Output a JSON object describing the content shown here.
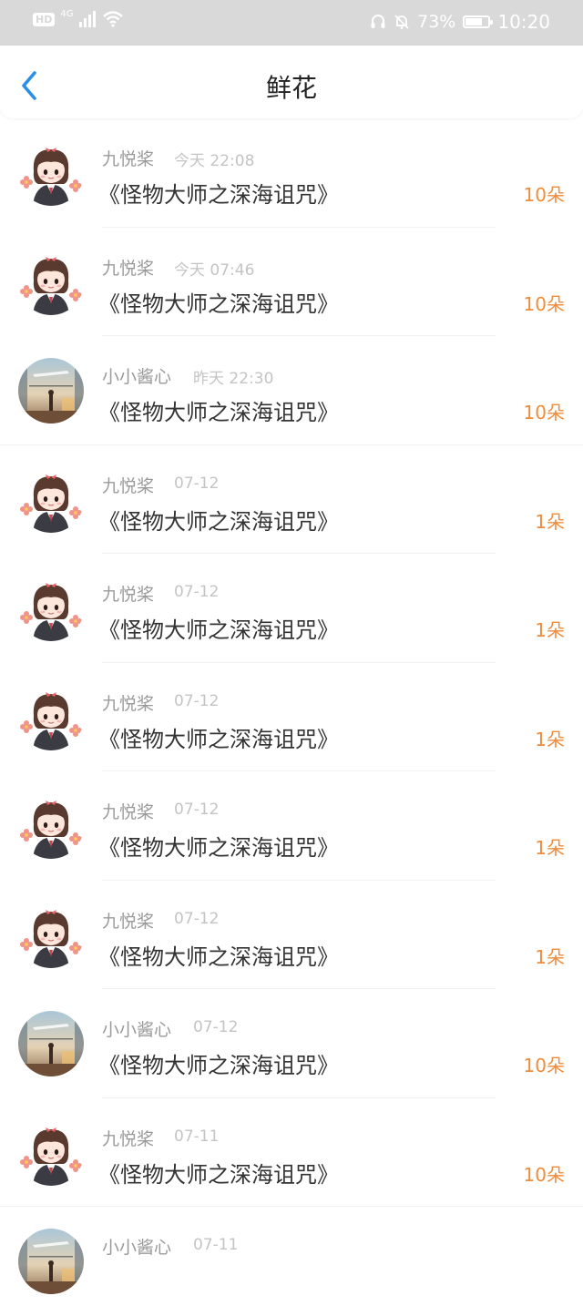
{
  "status_bar": {
    "hd": "HD",
    "network": "4G",
    "battery": "73%",
    "battery_level": 0.73,
    "time": "10:20"
  },
  "header": {
    "title": "鲜花"
  },
  "colors": {
    "accent_blue": "#2a8fe8",
    "count_orange": "#ef8c3c"
  },
  "items": [
    {
      "name": "九悦桨",
      "time": "今天 22:08",
      "title": "《怪物大师之深海诅咒》",
      "count": "10朵",
      "avatar": "girl"
    },
    {
      "name": "九悦桨",
      "time": "今天 07:46",
      "title": "《怪物大师之深海诅咒》",
      "count": "10朵",
      "avatar": "girl"
    },
    {
      "name": "小小酱心",
      "time": "昨天 22:30",
      "title": "《怪物大师之深海诅咒》",
      "count": "10朵",
      "avatar": "scene"
    },
    {
      "name": "九悦桨",
      "time": "07-12",
      "title": "《怪物大师之深海诅咒》",
      "count": "1朵",
      "avatar": "girl"
    },
    {
      "name": "九悦桨",
      "time": "07-12",
      "title": "《怪物大师之深海诅咒》",
      "count": "1朵",
      "avatar": "girl"
    },
    {
      "name": "九悦桨",
      "time": "07-12",
      "title": "《怪物大师之深海诅咒》",
      "count": "1朵",
      "avatar": "girl"
    },
    {
      "name": "九悦桨",
      "time": "07-12",
      "title": "《怪物大师之深海诅咒》",
      "count": "1朵",
      "avatar": "girl"
    },
    {
      "name": "九悦桨",
      "time": "07-12",
      "title": "《怪物大师之深海诅咒》",
      "count": "1朵",
      "avatar": "girl"
    },
    {
      "name": "小小酱心",
      "time": "07-12",
      "title": "《怪物大师之深海诅咒》",
      "count": "10朵",
      "avatar": "scene"
    },
    {
      "name": "九悦桨",
      "time": "07-11",
      "title": "《怪物大师之深海诅咒》",
      "count": "10朵",
      "avatar": "girl"
    },
    {
      "name": "小小酱心",
      "time": "07-11",
      "title": "",
      "count": "",
      "avatar": "scene"
    }
  ]
}
